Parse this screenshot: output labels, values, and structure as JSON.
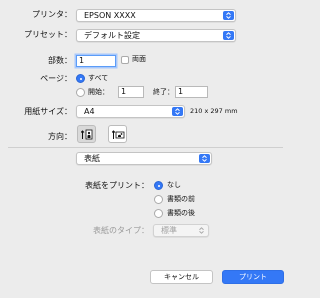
{
  "printer": {
    "label": "プリンタ：",
    "value": "EPSON XXXX"
  },
  "preset": {
    "label": "プリセット：",
    "value": "デフォルト設定"
  },
  "copies": {
    "label": "部数：",
    "value": "1",
    "duplex_label": "両面"
  },
  "pages": {
    "label": "ページ：",
    "all_label": "すべて",
    "from_label": "開始：",
    "from_value": "1",
    "to_label": "終了：",
    "to_value": "1",
    "selected": "all"
  },
  "paper": {
    "label": "用紙サイズ：",
    "value": "A4",
    "dimensions": "210 x 297 mm"
  },
  "orientation": {
    "label": "方向：",
    "selected": "portrait"
  },
  "section_popup": {
    "value": "表紙"
  },
  "cover": {
    "print_label": "表紙をプリント：",
    "options": [
      "なし",
      "書類の前",
      "書類の後"
    ],
    "selected": "なし",
    "type_label": "表紙のタイプ：",
    "type_value": "標準"
  },
  "buttons": {
    "cancel": "キャンセル",
    "print": "プリント"
  },
  "colors": {
    "accent": "#3478f6",
    "window_bg": "#ececec"
  },
  "icons": {
    "stepper": "up-down-chevron-icon",
    "portrait": "portrait-orientation-icon",
    "landscape": "landscape-orientation-icon"
  }
}
